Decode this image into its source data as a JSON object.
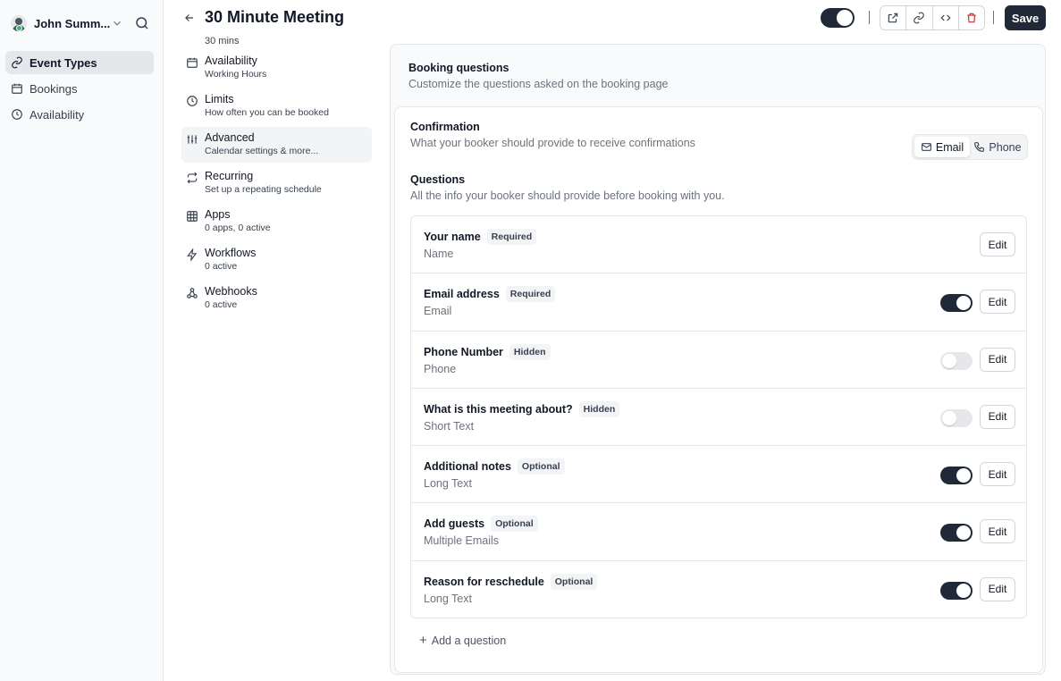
{
  "sidebar": {
    "user_name": "John Summ...",
    "items": [
      {
        "label": "Event Types",
        "icon": "link-icon",
        "active": true
      },
      {
        "label": "Bookings",
        "icon": "calendar-icon",
        "active": false
      },
      {
        "label": "Availability",
        "icon": "clock-icon",
        "active": false
      }
    ]
  },
  "header": {
    "title": "30 Minute Meeting",
    "save_label": "Save"
  },
  "event_tabs": {
    "partial_top": "30 mins",
    "items": [
      {
        "title": "Availability",
        "subtitle": "Working Hours",
        "icon": "calendar-icon"
      },
      {
        "title": "Limits",
        "subtitle": "How often you can be booked",
        "icon": "clock-icon"
      },
      {
        "title": "Advanced",
        "subtitle": "Calendar settings & more...",
        "icon": "sliders-icon",
        "active": true
      },
      {
        "title": "Recurring",
        "subtitle": "Set up a repeating schedule",
        "icon": "repeat-icon"
      },
      {
        "title": "Apps",
        "subtitle": "0 apps, 0 active",
        "icon": "grid-icon"
      },
      {
        "title": "Workflows",
        "subtitle": "0 active",
        "icon": "zap-icon"
      },
      {
        "title": "Webhooks",
        "subtitle": "0 active",
        "icon": "webhook-icon"
      }
    ]
  },
  "booking": {
    "title": "Booking questions",
    "description": "Customize the questions asked on the booking page",
    "confirmation": {
      "title": "Confirmation",
      "description": "What your booker should provide to receive confirmations",
      "options": [
        "Email",
        "Phone"
      ],
      "selected": "Email"
    },
    "questions_title": "Questions",
    "questions_description": "All the info your booker should provide before booking with you.",
    "questions": [
      {
        "label": "Your name",
        "badge": "Required",
        "type": "Name",
        "toggle": null
      },
      {
        "label": "Email address",
        "badge": "Required",
        "type": "Email",
        "toggle": true
      },
      {
        "label": "Phone Number",
        "badge": "Hidden",
        "type": "Phone",
        "toggle": false
      },
      {
        "label": "What is this meeting about?",
        "badge": "Hidden",
        "type": "Short Text",
        "toggle": false
      },
      {
        "label": "Additional notes",
        "badge": "Optional",
        "type": "Long Text",
        "toggle": true
      },
      {
        "label": "Add guests",
        "badge": "Optional",
        "type": "Multiple Emails",
        "toggle": true
      },
      {
        "label": "Reason for reschedule",
        "badge": "Optional",
        "type": "Long Text",
        "toggle": true
      }
    ],
    "edit_label": "Edit",
    "add_question_label": "Add a question"
  }
}
